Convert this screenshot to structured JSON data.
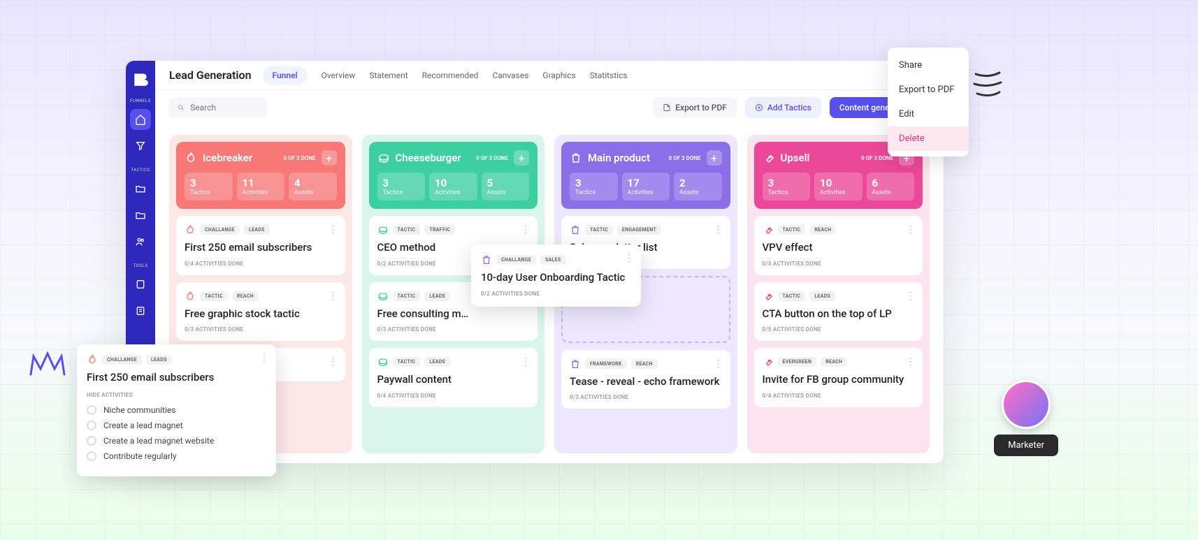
{
  "page_title": "Lead Generation",
  "chip": "Funnel",
  "nav": [
    "Overview",
    "Statement",
    "Recommended",
    "Canvases",
    "Graphics",
    "Statitstics"
  ],
  "search_placeholder": "Search",
  "toolbar": {
    "export": "Export to PDF",
    "add": "Add Tactics",
    "generator": "Content generator"
  },
  "sidebar": {
    "labels": [
      "FUNNELS",
      "TACTICS",
      "TOOLS"
    ]
  },
  "context_menu": [
    "Share",
    "Export to PDF",
    "Edit",
    "Delete"
  ],
  "columns": [
    {
      "key": "ice",
      "name": "Icebreaker",
      "done": "0 OF 3 DONE",
      "stats": [
        {
          "n": "3",
          "l": "Tactics"
        },
        {
          "n": "11",
          "l": "Activities"
        },
        {
          "n": "4",
          "l": "Assets"
        }
      ],
      "cards": [
        {
          "tags": [
            "CHALLANGE",
            "LEADS"
          ],
          "title": "First 250 email subscribers",
          "meta": "0/4 ACTIVITIES DONE"
        },
        {
          "tags": [
            "TACTIC",
            "REACH"
          ],
          "title": "Free graphic stock tactic",
          "meta": "0/3 ACTIVITIES DONE"
        },
        {
          "tags": [],
          "title": "",
          "meta": ""
        }
      ]
    },
    {
      "key": "cheese",
      "name": "Cheeseburger",
      "done": "0 OF 3 DONE",
      "stats": [
        {
          "n": "3",
          "l": "Tactics"
        },
        {
          "n": "10",
          "l": "Activities"
        },
        {
          "n": "5",
          "l": "Assets"
        }
      ],
      "cards": [
        {
          "tags": [
            "TACTIC",
            "TRAFFIC"
          ],
          "title": "CEO method",
          "meta": "0/2 ACTIVITIES DONE"
        },
        {
          "tags": [
            "TACTIC",
            "LEADS"
          ],
          "title": "Free consulting m…",
          "meta": "0/3 ACTIVITIES DONE"
        },
        {
          "tags": [
            "TACTIC",
            "LEADS"
          ],
          "title": "Paywall content",
          "meta": "0/4 ACTIVITIES DONE"
        }
      ]
    },
    {
      "key": "main",
      "name": "Main product",
      "done": "0 OF 3 DONE",
      "stats": [
        {
          "n": "3",
          "l": "Tactics"
        },
        {
          "n": "17",
          "l": "Activities"
        },
        {
          "n": "2",
          "l": "Assets"
        }
      ],
      "cards": [
        {
          "tags": [
            "TACTIC",
            "ENGAGEMENT"
          ],
          "title": "Sub-newsletter list",
          "meta": ""
        },
        {
          "tags": [
            "FRAMEWORK",
            "REACH"
          ],
          "title": "Tease - reveal - echo framework",
          "meta": "0/3 ACTIVITIES DONE"
        }
      ]
    },
    {
      "key": "upsell",
      "name": "Upsell",
      "done": "0 OF 3 DONE",
      "stats": [
        {
          "n": "3",
          "l": "Tactics"
        },
        {
          "n": "10",
          "l": "Activities"
        },
        {
          "n": "6",
          "l": "Assets"
        }
      ],
      "cards": [
        {
          "tags": [
            "TACTIC",
            "REACH"
          ],
          "title": "VPV effect",
          "meta": "0/3 ACTIVITIES DONE"
        },
        {
          "tags": [
            "TACTIC",
            "LEADS"
          ],
          "title": "CTA button on the top of LP",
          "meta": "0/5 ACTIVITIES DONE"
        },
        {
          "tags": [
            "EVERGREEN",
            "REACH"
          ],
          "title": "Invite for FB group community",
          "meta": "0/4 ACTIVITIES DONE"
        }
      ]
    }
  ],
  "popup_detail": {
    "tags": [
      "CHALLANGE",
      "LEADS"
    ],
    "title": "First 250 email subscribers",
    "hide": "HIDE ACTIVITIES",
    "activities": [
      "Niche communities",
      "Create a lead magnet",
      "Create a lead magnet website",
      "Contribute regularly"
    ]
  },
  "popup_onboard": {
    "tags": [
      "CHALLANGE",
      "SALES"
    ],
    "title": "10-day User Onboarding Tactic",
    "meta": "0/2 ACTIVITIES DONE"
  },
  "avatar_label": "Marketer"
}
